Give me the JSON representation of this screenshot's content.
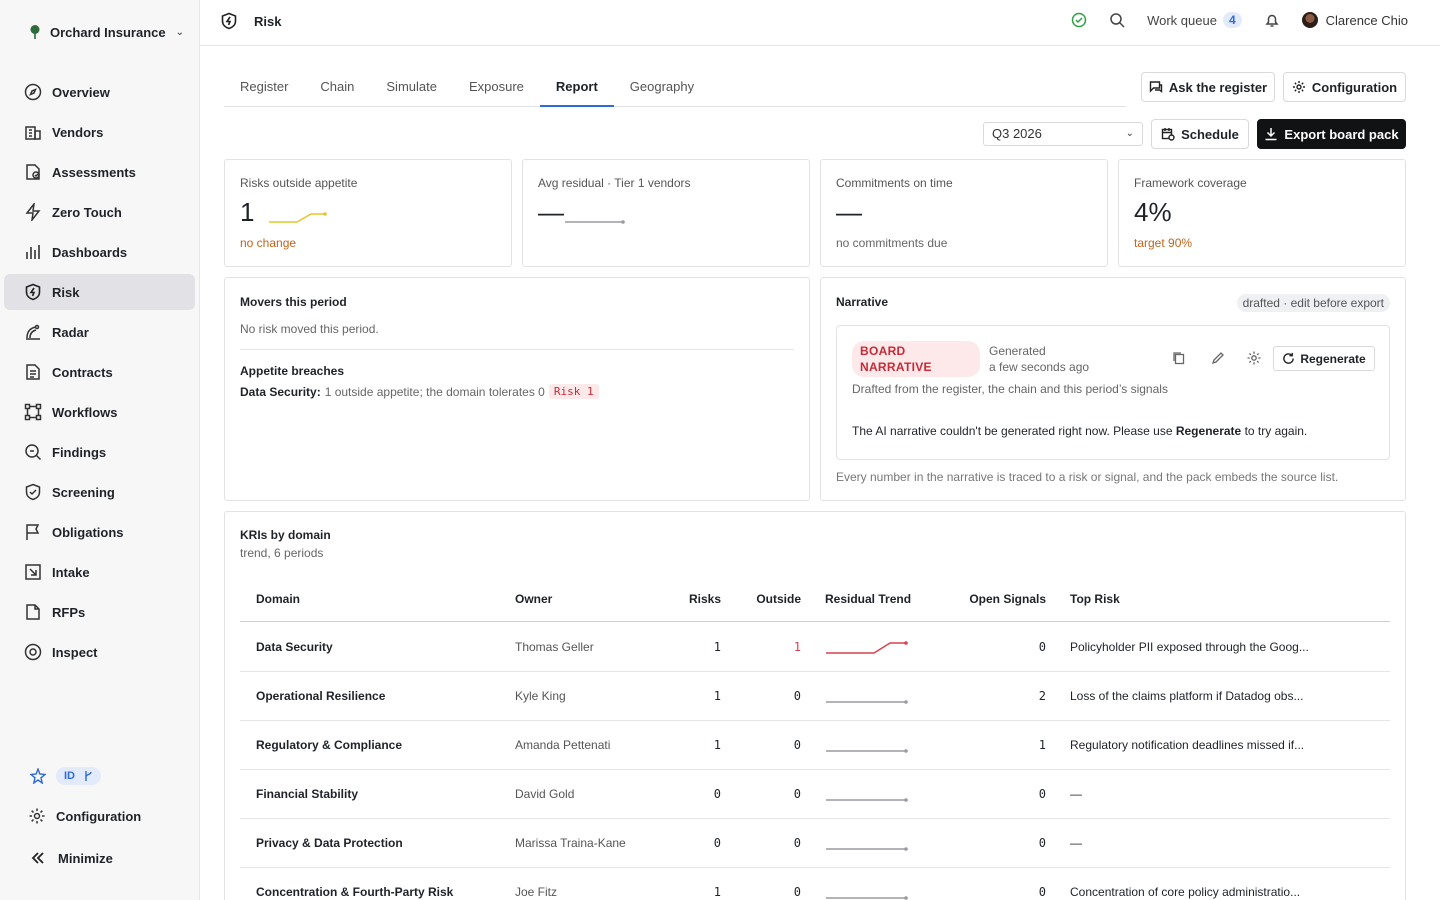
{
  "org": {
    "name": "Orchard Insurance"
  },
  "nav": [
    {
      "label": "Overview",
      "icon": "compass-icon"
    },
    {
      "label": "Vendors",
      "icon": "building-icon"
    },
    {
      "label": "Assessments",
      "icon": "document-check-icon"
    },
    {
      "label": "Zero Touch",
      "icon": "bolt-icon"
    },
    {
      "label": "Dashboards",
      "icon": "bar-chart-icon"
    },
    {
      "label": "Risk",
      "icon": "shield-bolt-icon",
      "active": true
    },
    {
      "label": "Radar",
      "icon": "radar-icon"
    },
    {
      "label": "Contracts",
      "icon": "contract-icon"
    },
    {
      "label": "Workflows",
      "icon": "workflow-icon"
    },
    {
      "label": "Findings",
      "icon": "magnifier-doc-icon"
    },
    {
      "label": "Screening",
      "icon": "shield-check-icon"
    },
    {
      "label": "Obligations",
      "icon": "flag-icon"
    },
    {
      "label": "Intake",
      "icon": "inbox-arrow-icon"
    },
    {
      "label": "RFPs",
      "icon": "rfp-doc-icon"
    },
    {
      "label": "Inspect",
      "icon": "eye-icon"
    }
  ],
  "sidebar_bottom": {
    "id_badge": "ID",
    "configuration": "Configuration",
    "minimize": "Minimize"
  },
  "topbar": {
    "section": "Risk",
    "work_queue": "Work queue",
    "work_queue_count": "4",
    "user": "Clarence Chio"
  },
  "tabs": [
    {
      "label": "Register"
    },
    {
      "label": "Chain"
    },
    {
      "label": "Simulate"
    },
    {
      "label": "Exposure"
    },
    {
      "label": "Report",
      "active": true
    },
    {
      "label": "Geography"
    }
  ],
  "actions": {
    "ask": "Ask the register",
    "configuration": "Configuration",
    "period": "Q3 2026",
    "schedule": "Schedule",
    "export": "Export board pack"
  },
  "kpis": [
    {
      "label": "Risks outside appetite",
      "value": "1",
      "sub": "no change",
      "sub_tone": "orange",
      "spark": [
        0,
        0,
        0,
        1,
        1
      ],
      "spark_color": "#e6c52a"
    },
    {
      "label": "Avg residual · Tier 1 vendors",
      "value": "—",
      "sub": "",
      "sub_tone": "muted",
      "spark": [
        0,
        0,
        0,
        0,
        0
      ],
      "spark_color": "#9a9aa0"
    },
    {
      "label": "Commitments on time",
      "value": "—",
      "sub": "no commitments due",
      "sub_tone": "muted"
    },
    {
      "label": "Framework coverage",
      "value": "4%",
      "sub": "target 90%",
      "sub_tone": "orange"
    }
  ],
  "movers": {
    "title": "Movers this period",
    "empty": "No risk moved this period.",
    "breaches_title": "Appetite breaches",
    "breach_domain": "Data Security:",
    "breach_text": "1 outside appetite; the domain tolerates 0",
    "breach_chip": "Risk 1"
  },
  "narrative": {
    "title": "Narrative",
    "status": "drafted · edit before export",
    "tag": "BOARD NARRATIVE",
    "generated_label": "Generated",
    "generated_time": "a few seconds ago",
    "regenerate": "Regenerate",
    "drafted_from": "Drafted from the register, the chain and this period’s signals",
    "error_prefix": "The AI narrative couldn't be generated right now. Please use",
    "error_bold": "Regenerate",
    "error_suffix": "to try again.",
    "footnote": "Every number in the narrative is traced to a risk or signal, and the pack embeds the source list."
  },
  "kri": {
    "title": "KRIs by domain",
    "subtitle": "trend, 6 periods",
    "columns": [
      "Domain",
      "Owner",
      "Risks",
      "Outside",
      "Residual Trend",
      "Open Signals",
      "Top Risk"
    ],
    "rows": [
      {
        "domain": "Data Security",
        "owner": "Thomas Geller",
        "risks": "1",
        "outside": "1",
        "trend": [
          0,
          0,
          0,
          0,
          1,
          1
        ],
        "trend_color": "#d9424e",
        "signals": "0",
        "top": "Policyholder PII exposed through the Goog..."
      },
      {
        "domain": "Operational Resilience",
        "owner": "Kyle King",
        "risks": "1",
        "outside": "0",
        "trend": [
          0,
          0,
          0,
          0,
          0,
          0
        ],
        "trend_color": "#9a9aa0",
        "signals": "2",
        "top": "Loss of the claims platform if Datadog obs..."
      },
      {
        "domain": "Regulatory & Compliance",
        "owner": "Amanda Pettenati",
        "risks": "1",
        "outside": "0",
        "trend": [
          0,
          0,
          0,
          0,
          0,
          0
        ],
        "trend_color": "#9a9aa0",
        "signals": "1",
        "top": "Regulatory notification deadlines missed if..."
      },
      {
        "domain": "Financial Stability",
        "owner": "David Gold",
        "risks": "0",
        "outside": "0",
        "trend": [
          0,
          0,
          0,
          0,
          0,
          0
        ],
        "trend_color": "#9a9aa0",
        "signals": "0",
        "top": "—"
      },
      {
        "domain": "Privacy & Data Protection",
        "owner": "Marissa Traina-Kane",
        "risks": "0",
        "outside": "0",
        "trend": [
          0,
          0,
          0,
          0,
          0,
          0
        ],
        "trend_color": "#9a9aa0",
        "signals": "0",
        "top": "—"
      },
      {
        "domain": "Concentration & Fourth-Party Risk",
        "owner": "Joe Fitz",
        "risks": "1",
        "outside": "0",
        "trend": [
          0,
          0,
          0,
          0,
          0,
          0
        ],
        "trend_color": "#9a9aa0",
        "signals": "0",
        "top": "Concentration of core policy administratio..."
      }
    ]
  }
}
